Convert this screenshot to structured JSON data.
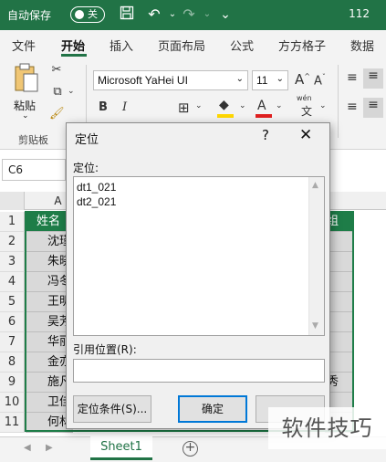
{
  "titlebar": {
    "autosave_label": "自动保存",
    "toggle_state": "关",
    "right_text": "112"
  },
  "ribbon_tabs": [
    "文件",
    "开始",
    "插入",
    "页面布局",
    "公式",
    "方方格子",
    "数据"
  ],
  "ribbon": {
    "paste_label": "粘贴",
    "clipboard_group": "剪贴板",
    "font_name": "Microsoft YaHei UI",
    "font_size": "11",
    "bold": "B",
    "italic": "I",
    "grow_font": "A",
    "shrink_font": "A",
    "font_color": "A",
    "phonetic": "wén",
    "underline_accent_color": "#e02020",
    "highlight_color": "#ffd700"
  },
  "formula_bar": {
    "name_box": "C6"
  },
  "sheet": {
    "col_a_header": "A",
    "row_numbers": [
      "1",
      "2",
      "3",
      "4",
      "5",
      "6",
      "7",
      "8",
      "9",
      "10",
      "11"
    ],
    "col_a_cells": [
      "姓名",
      "沈瑾",
      "朱晓",
      "冯冬",
      "王明",
      "吴芳",
      "华丽",
      "金亦",
      "施凡",
      "卫佳",
      "何林"
    ],
    "right_col_head": "组",
    "right_col_row9": "秀",
    "header_fill": "#1e7d48",
    "body_fill": "#d9d9d9"
  },
  "sheet_tabs": {
    "active_tab": "Sheet1",
    "add_symbol": "+"
  },
  "dialog": {
    "title": "定位",
    "help": "?",
    "close": "✕",
    "goto_label": "定位:",
    "references": [
      "dt1_021",
      "dt2_021"
    ],
    "ref_label": "引用位置(R):",
    "ref_value": "",
    "special_button": "定位条件(S)...",
    "ok_button": "确定",
    "cancel_button": ""
  },
  "watermark": "软件技巧"
}
